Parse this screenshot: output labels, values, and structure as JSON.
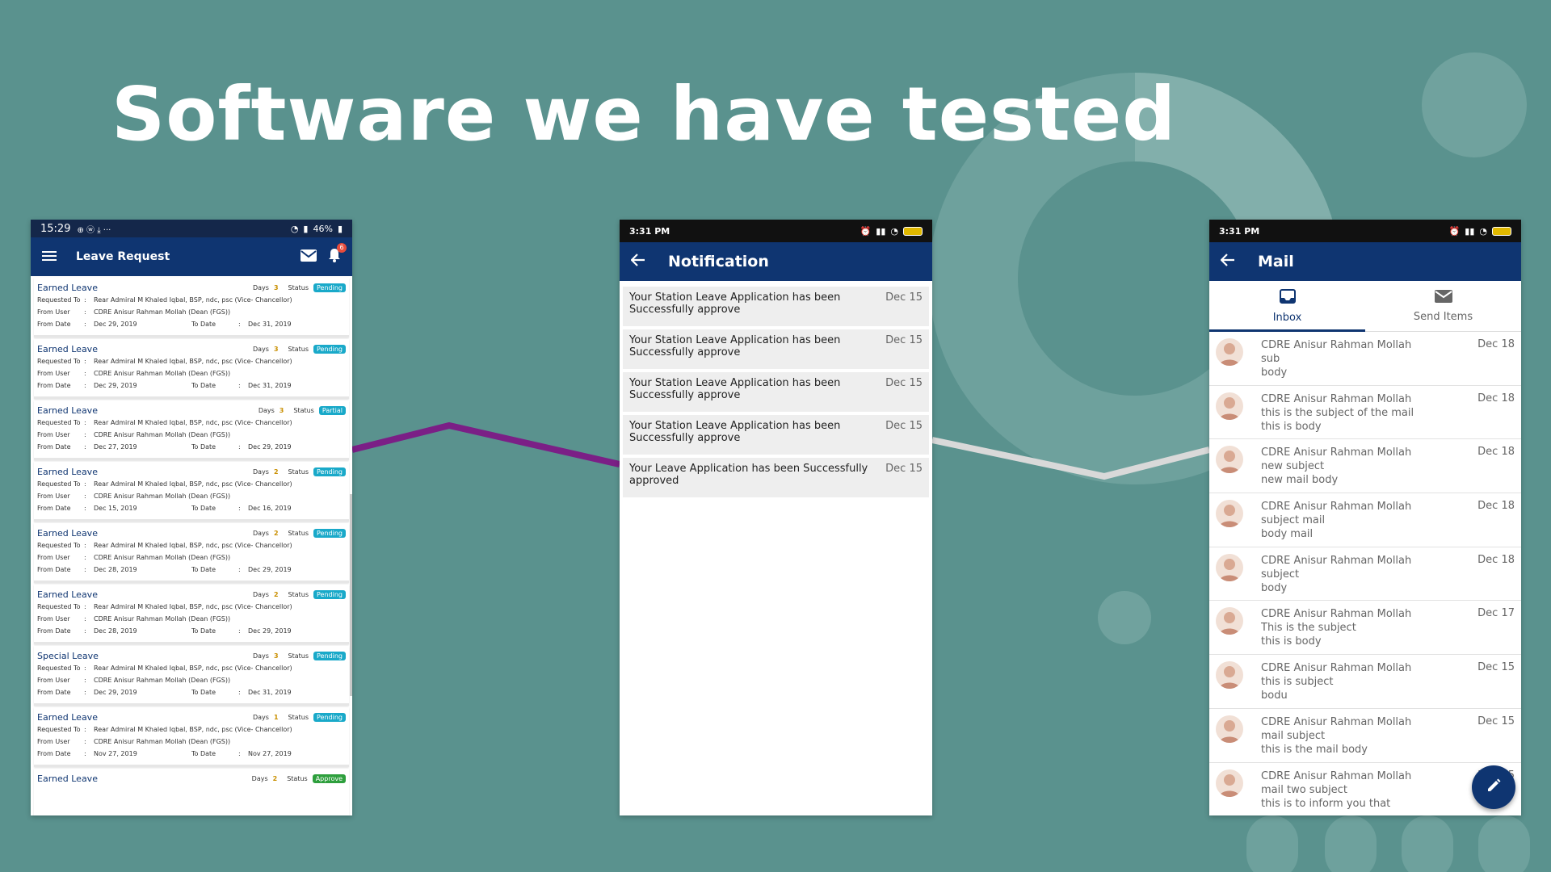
{
  "slide": {
    "title": "Software we have tested",
    "colors": {
      "background": "#5a928e",
      "connector1": "#7b1f86",
      "connector2": "#d9d9d9",
      "app_blue": "#0f3571"
    }
  },
  "phone1": {
    "status": {
      "time": "15:29",
      "right": "46%",
      "icons_left": "⊕ ⓦ ⤓ ···"
    },
    "title": "Leave Request",
    "icons": [
      "menu-icon",
      "mail-icon",
      "bell-icon"
    ],
    "notification_badge": "6",
    "labels": {
      "days": "Days",
      "status": "Status",
      "requested_to": "Requested To",
      "from_user": "From User",
      "from_date": "From Date",
      "to_date": "To Date"
    },
    "requests": [
      {
        "type": "Earned Leave",
        "days": "3",
        "status": "Pending",
        "to": "Rear Admiral M Khaled Iqbal, BSP, ndc, psc (Vice- Chancellor)",
        "from": "CDRE Anisur Rahman Mollah (Dean (FGS))",
        "from_date": "Dec 29, 2019",
        "to_date": "Dec 31, 2019"
      },
      {
        "type": "Earned Leave",
        "days": "3",
        "status": "Pending",
        "to": "Rear Admiral M Khaled Iqbal, BSP, ndc, psc (Vice- Chancellor)",
        "from": "CDRE Anisur Rahman Mollah (Dean (FGS))",
        "from_date": "Dec 29, 2019",
        "to_date": "Dec 31, 2019"
      },
      {
        "type": "Earned Leave",
        "days": "3",
        "status": "Partial",
        "to": "Rear Admiral M Khaled Iqbal, BSP, ndc, psc (Vice- Chancellor)",
        "from": "CDRE Anisur Rahman Mollah (Dean (FGS))",
        "from_date": "Dec 27, 2019",
        "to_date": "Dec 29, 2019"
      },
      {
        "type": "Earned Leave",
        "days": "2",
        "status": "Pending",
        "to": "Rear Admiral M Khaled Iqbal, BSP, ndc, psc (Vice- Chancellor)",
        "from": "CDRE Anisur Rahman Mollah (Dean (FGS))",
        "from_date": "Dec 15, 2019",
        "to_date": "Dec 16, 2019"
      },
      {
        "type": "Earned Leave",
        "days": "2",
        "status": "Pending",
        "to": "Rear Admiral M Khaled Iqbal, BSP, ndc, psc (Vice- Chancellor)",
        "from": "CDRE Anisur Rahman Mollah (Dean (FGS))",
        "from_date": "Dec 28, 2019",
        "to_date": "Dec 29, 2019"
      },
      {
        "type": "Earned Leave",
        "days": "2",
        "status": "Pending",
        "to": "Rear Admiral M Khaled Iqbal, BSP, ndc, psc (Vice- Chancellor)",
        "from": "CDRE Anisur Rahman Mollah (Dean (FGS))",
        "from_date": "Dec 28, 2019",
        "to_date": "Dec 29, 2019"
      },
      {
        "type": "Special Leave",
        "days": "3",
        "status": "Pending",
        "to": "Rear Admiral M Khaled Iqbal, BSP, ndc, psc (Vice- Chancellor)",
        "from": "CDRE Anisur Rahman Mollah (Dean (FGS))",
        "from_date": "Dec 29, 2019",
        "to_date": "Dec 31, 2019"
      },
      {
        "type": "Earned Leave",
        "days": "1",
        "status": "Pending",
        "to": "Rear Admiral M Khaled Iqbal, BSP, ndc, psc (Vice- Chancellor)",
        "from": "CDRE Anisur Rahman Mollah (Dean (FGS))",
        "from_date": "Nov 27, 2019",
        "to_date": "Nov 27, 2019"
      },
      {
        "type": "Earned Leave",
        "days": "2",
        "status": "Approve",
        "to": "",
        "from": "",
        "from_date": "",
        "to_date": ""
      }
    ]
  },
  "phone2": {
    "status": {
      "time": "3:31 PM"
    },
    "title": "Notification",
    "notifications": [
      {
        "message": "Your Station Leave Application has been Successfully approve",
        "date": "Dec 15"
      },
      {
        "message": "Your Station Leave Application has been Successfully approve",
        "date": "Dec 15"
      },
      {
        "message": "Your Station Leave Application has been Successfully approve",
        "date": "Dec 15"
      },
      {
        "message": "Your Station Leave Application has been Successfully approve",
        "date": "Dec 15"
      },
      {
        "message": "Your Leave Application has been Successfully approved",
        "date": "Dec 15"
      }
    ]
  },
  "phone3": {
    "status": {
      "time": "3:31 PM"
    },
    "title": "Mail",
    "tabs": [
      {
        "label": "Inbox",
        "icon": "inbox-icon"
      },
      {
        "label": "Send Items",
        "icon": "mail-icon"
      }
    ],
    "mails": [
      {
        "sender": "CDRE Anisur Rahman Mollah",
        "subject": "sub",
        "body": "body",
        "date": "Dec 18"
      },
      {
        "sender": "CDRE Anisur Rahman Mollah",
        "subject": "this is the subject of the mail",
        "body": "this is body",
        "date": "Dec 18"
      },
      {
        "sender": "CDRE Anisur Rahman Mollah",
        "subject": "new subject",
        "body": "new mail body",
        "date": "Dec 18"
      },
      {
        "sender": "CDRE Anisur Rahman Mollah",
        "subject": "subject mail",
        "body": "body mail",
        "date": "Dec 18"
      },
      {
        "sender": "CDRE Anisur Rahman Mollah",
        "subject": "subject",
        "body": "body",
        "date": "Dec 18"
      },
      {
        "sender": "CDRE Anisur Rahman Mollah",
        "subject": "This is the subject",
        "body": "this is body",
        "date": "Dec 17"
      },
      {
        "sender": "CDRE Anisur Rahman Mollah",
        "subject": "this is subject",
        "body": "bodu",
        "date": "Dec 15"
      },
      {
        "sender": "CDRE Anisur Rahman Mollah",
        "subject": "mail subject",
        "body": "this is the mail body",
        "date": "Dec 15"
      },
      {
        "sender": "CDRE Anisur Rahman Mollah",
        "subject": "mail two subject",
        "body": "this is to inform you that",
        "date": "Dec 15"
      }
    ],
    "fab_icon": "pencil-icon"
  }
}
